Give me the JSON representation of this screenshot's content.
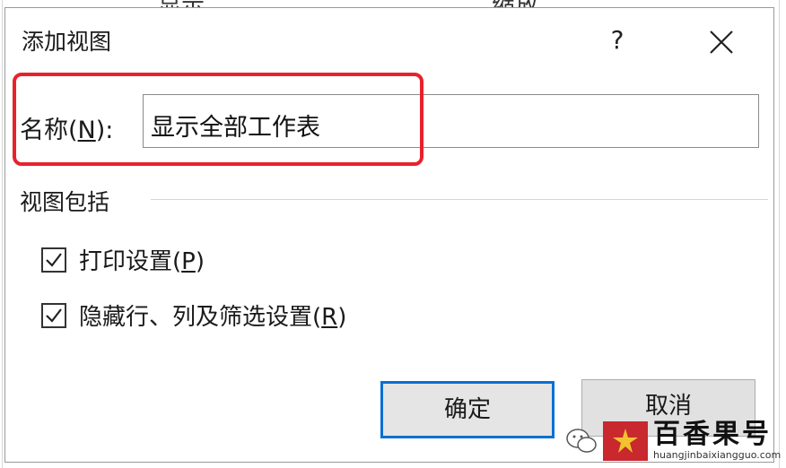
{
  "background": {
    "header_left": "显示",
    "header_right": "缩放"
  },
  "dialog": {
    "title": "添加视图",
    "help_label": "?",
    "name_label_prefix": "名称(",
    "name_label_key": "N",
    "name_label_suffix": "):",
    "name_value": "显示全部工作表",
    "group_label": "视图包括",
    "checkboxes": [
      {
        "prefix": "打印设置(",
        "key": "P",
        "suffix": ")",
        "checked": true
      },
      {
        "prefix": "隐藏行、列及筛选设置(",
        "key": "R",
        "suffix": ")",
        "checked": true
      }
    ],
    "ok_label": "确定",
    "cancel_label": "取消"
  },
  "watermark": {
    "brand": "百香果号",
    "url": "huangjinbaixiangguo.com"
  },
  "colors": {
    "highlight": "#e8222b",
    "focus_border": "#0a6fd4",
    "logo_red": "#c8282e"
  }
}
